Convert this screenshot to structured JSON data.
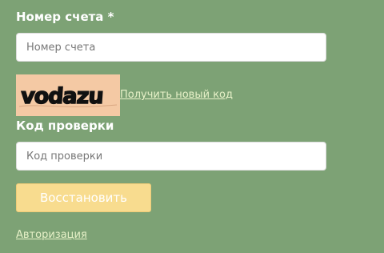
{
  "form": {
    "account_label": "Номер счета *",
    "account_placeholder": "Номер счета",
    "account_value": "",
    "captcha_text": "vodazu",
    "new_code_link": "Получить новый код",
    "code_label": "Код проверки",
    "code_placeholder": "Код проверки",
    "code_value": "",
    "restore_button": "Восстановить",
    "auth_link": "Авторизация"
  },
  "colors": {
    "background": "#7da275",
    "button": "#f8dc8f",
    "captcha_bg": "#f4c9a4",
    "link": "#e7f1c8"
  }
}
